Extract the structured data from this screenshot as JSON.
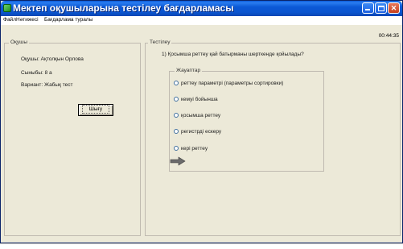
{
  "window": {
    "title": "Мектеп оқушыларына тестілеу бағдарламасы",
    "colors": {
      "titlebar": "#0b58d6",
      "face": "#ece9d8",
      "close": "#c6401d"
    }
  },
  "menu": {
    "items": [
      "Файл",
      "Нәтижесі",
      "Бағдарлама туралы"
    ]
  },
  "timer": "00:44:35",
  "student_panel": {
    "legend": "Оқушы",
    "name": "Оқушы: Ақтолқын Орлова",
    "class": "Сыныбы: 8 а",
    "variant": "Вариант: Жабық тест",
    "exit_label": "Шығу"
  },
  "test_panel": {
    "legend": "Тестілеу",
    "question": "1)  Қосымша реттеу қай батырманы шерткенде қойылады?",
    "answers_legend": "Жауаптар",
    "options": [
      "реттеу параметрі (параметры сортировки)",
      "кемуі бойынша",
      "қосымша реттеу",
      "регистрді ескеру",
      "кері реттеу"
    ],
    "next_icon": "right-arrow-icon"
  }
}
